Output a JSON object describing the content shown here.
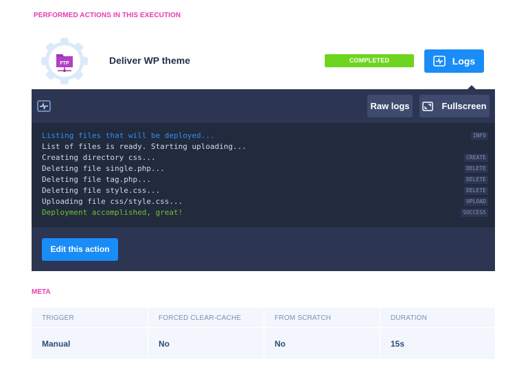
{
  "section_title": "PERFORMED ACTIONS IN THIS EXECUTION",
  "action": {
    "icon": "ftp-folder-icon",
    "icon_label": "FTP",
    "name": "Deliver WP theme",
    "status": "COMPLETED",
    "status_color": "#6dd51f",
    "logs_button": "Logs"
  },
  "logs_panel": {
    "toolbar_icon": "activity-monitor-icon",
    "raw_logs_button": "Raw logs",
    "fullscreen_button": "Fullscreen",
    "lines": [
      {
        "text": "Listing files that will be deployed...",
        "tag": "INFO",
        "color": "#2f8ff0"
      },
      {
        "text": "List of files is ready. Starting uploading...",
        "tag": "",
        "color": "#d4d8e2"
      },
      {
        "text": "Creating directory css...",
        "tag": "CREATE",
        "color": "#d4d8e2"
      },
      {
        "text": "Deleting file single.php...",
        "tag": "DELETE",
        "color": "#d4d8e2"
      },
      {
        "text": "Deleting file tag.php...",
        "tag": "DELETE",
        "color": "#d4d8e2"
      },
      {
        "text": "Deleting file style.css...",
        "tag": "DELETE",
        "color": "#d4d8e2"
      },
      {
        "text": "Uploading file css/style.css...",
        "tag": "UPLOAD",
        "color": "#d4d8e2"
      },
      {
        "text": "Deployment accomplished, great!",
        "tag": "SUCCESS",
        "color": "#6ec22c"
      }
    ],
    "edit_button": "Edit this action"
  },
  "meta": {
    "title": "META",
    "columns": [
      {
        "header": "TRIGGER",
        "value": "Manual"
      },
      {
        "header": "FORCED CLEAR-CACHE",
        "value": "No"
      },
      {
        "header": "FROM SCRATCH",
        "value": "No"
      },
      {
        "header": "DURATION",
        "value": "15s"
      }
    ]
  },
  "colors": {
    "accent_blue": "#1a8cf7",
    "accent_pink": "#e53bb0",
    "panel_bg": "#2c3552",
    "console_bg": "#222a3e"
  }
}
